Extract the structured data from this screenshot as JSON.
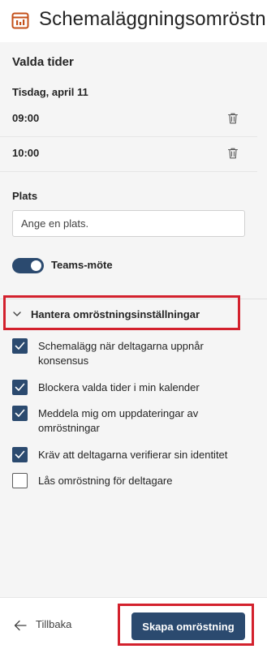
{
  "header": {
    "title": "Schemaläggningsomröstning",
    "icon": "poll-calendar-icon"
  },
  "selected_times": {
    "title": "Valda tider",
    "date": "Tisdag, april 11",
    "times": [
      {
        "label": "09:00"
      },
      {
        "label": "10:00"
      }
    ]
  },
  "location": {
    "label": "Plats",
    "placeholder": "Ange en plats.",
    "value": ""
  },
  "teams": {
    "label": "Teams-möte",
    "enabled": true
  },
  "settings": {
    "header": "Hantera omröstningsinställningar",
    "expanded": true,
    "options": [
      {
        "label": "Schemalägg när deltagarna uppnår konsensus",
        "checked": true
      },
      {
        "label": "Blockera valda tider i min kalender",
        "checked": true
      },
      {
        "label": "Meddela mig om uppdateringar av omröstningar",
        "checked": true
      },
      {
        "label": "Kräv att deltagarna verifierar sin identitet",
        "checked": true
      },
      {
        "label": "Lås omröstning för deltagare",
        "checked": false
      }
    ]
  },
  "footer": {
    "back_label": "Tillbaka",
    "primary_label": "Skapa omröstning"
  },
  "colors": {
    "accent": "#2b4a6f",
    "brand_icon": "#c4501a",
    "highlight": "#d3212d"
  }
}
